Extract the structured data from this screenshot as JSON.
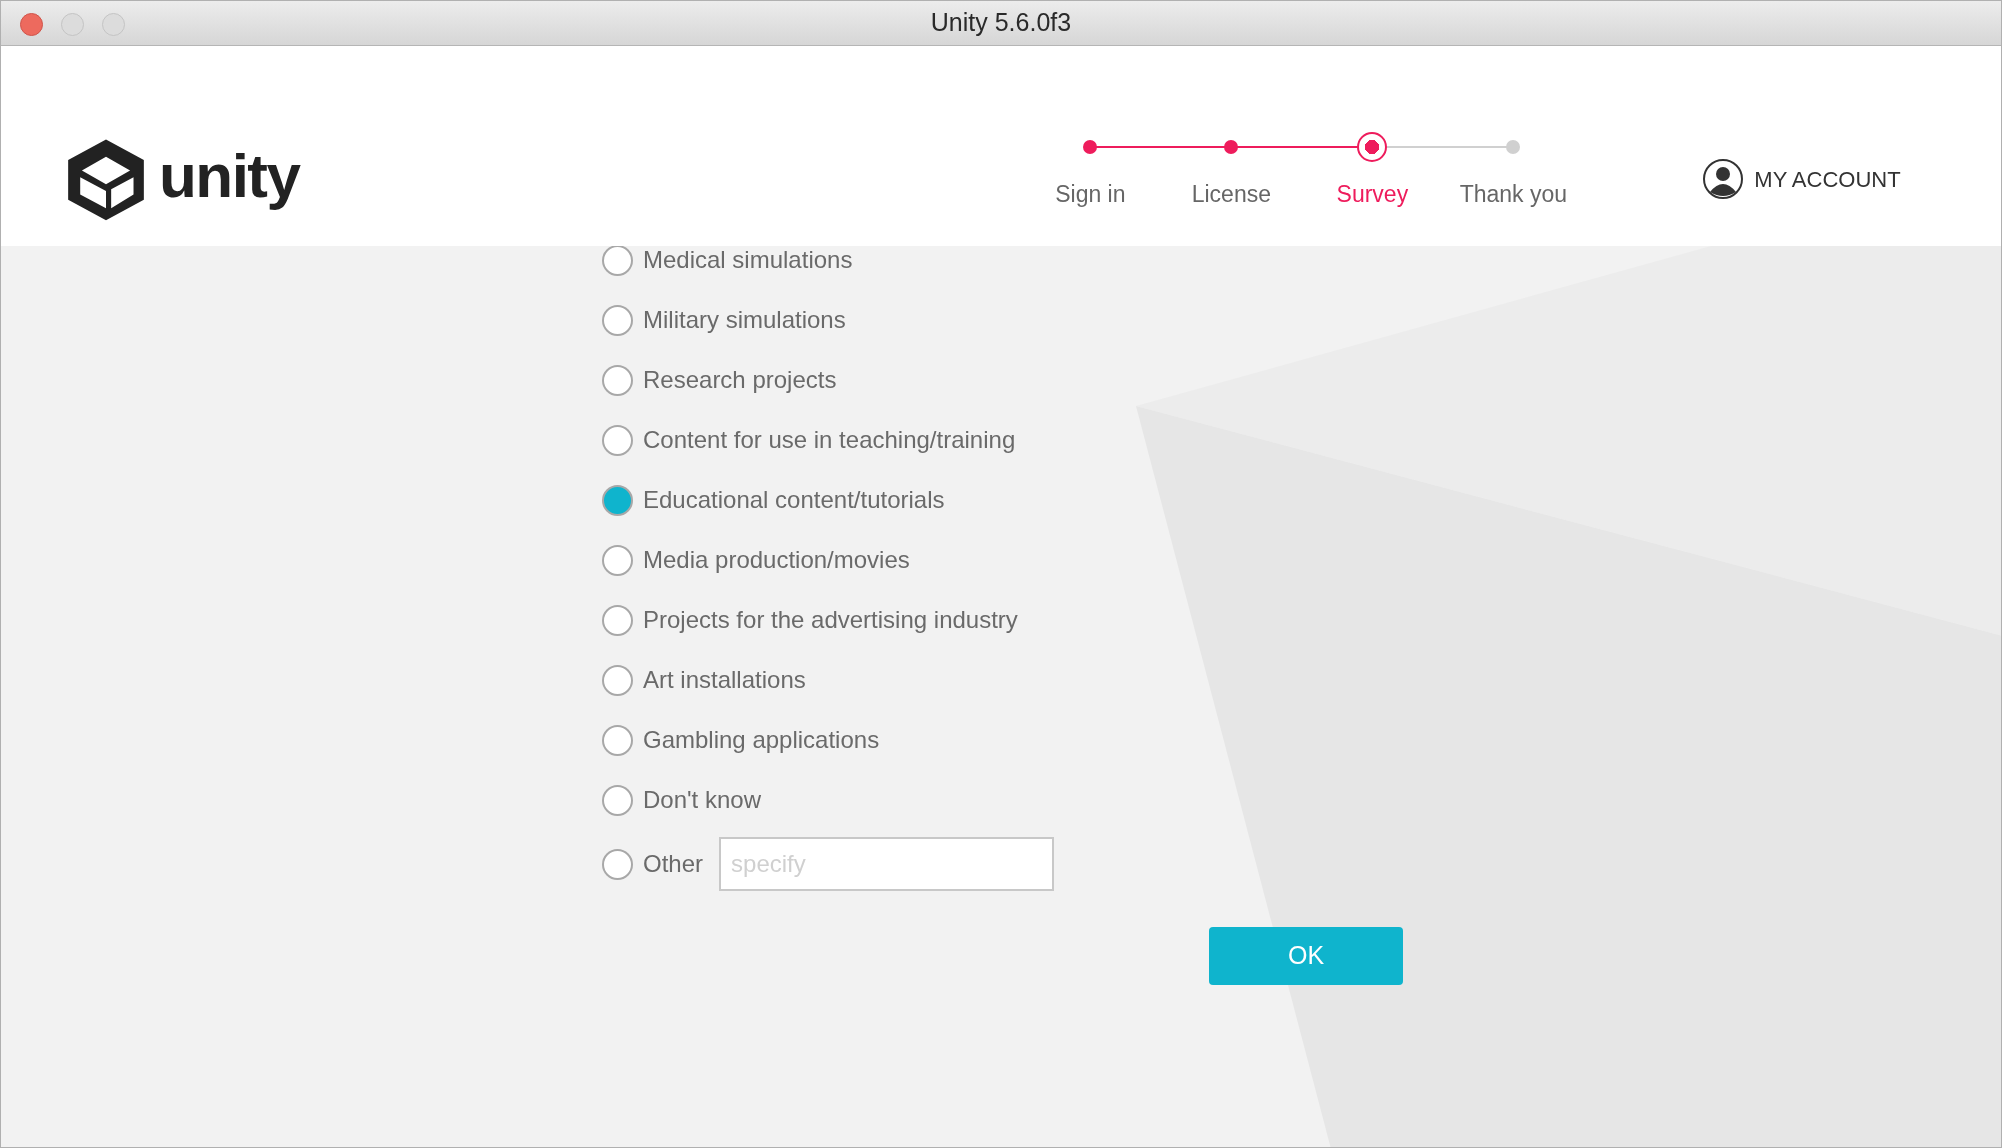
{
  "window": {
    "title": "Unity 5.6.0f3"
  },
  "logo": {
    "text": "unity"
  },
  "steps": [
    {
      "label": "Sign in",
      "completed": true,
      "selected": false
    },
    {
      "label": "License",
      "completed": true,
      "selected": false
    },
    {
      "label": "Survey",
      "completed": true,
      "selected": true
    },
    {
      "label": "Thank you",
      "completed": false,
      "selected": false
    }
  ],
  "account": {
    "label": "MY ACCOUNT"
  },
  "options": [
    {
      "label": "Medical simulations",
      "selected": false
    },
    {
      "label": "Military simulations",
      "selected": false
    },
    {
      "label": "Research projects",
      "selected": false
    },
    {
      "label": "Content for use in teaching/training",
      "selected": false
    },
    {
      "label": "Educational content/tutorials",
      "selected": true
    },
    {
      "label": "Media production/movies",
      "selected": false
    },
    {
      "label": "Projects for the advertising industry",
      "selected": false
    },
    {
      "label": "Art installations",
      "selected": false
    },
    {
      "label": "Gambling applications",
      "selected": false
    },
    {
      "label": "Don't know",
      "selected": false
    }
  ],
  "other": {
    "label": "Other",
    "selected": false,
    "placeholder": "specify"
  },
  "ok_button": {
    "label": "OK"
  }
}
